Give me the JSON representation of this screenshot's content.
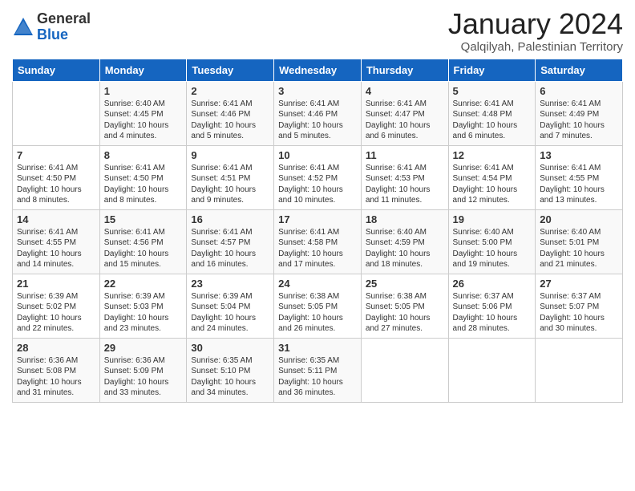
{
  "logo": {
    "general": "General",
    "blue": "Blue"
  },
  "header": {
    "month_title": "January 2024",
    "location": "Qalqilyah, Palestinian Territory"
  },
  "weekdays": [
    "Sunday",
    "Monday",
    "Tuesday",
    "Wednesday",
    "Thursday",
    "Friday",
    "Saturday"
  ],
  "weeks": [
    [
      {
        "day": "",
        "sunrise": "",
        "sunset": "",
        "daylight": ""
      },
      {
        "day": "1",
        "sunrise": "Sunrise: 6:40 AM",
        "sunset": "Sunset: 4:45 PM",
        "daylight": "Daylight: 10 hours and 4 minutes."
      },
      {
        "day": "2",
        "sunrise": "Sunrise: 6:41 AM",
        "sunset": "Sunset: 4:46 PM",
        "daylight": "Daylight: 10 hours and 5 minutes."
      },
      {
        "day": "3",
        "sunrise": "Sunrise: 6:41 AM",
        "sunset": "Sunset: 4:46 PM",
        "daylight": "Daylight: 10 hours and 5 minutes."
      },
      {
        "day": "4",
        "sunrise": "Sunrise: 6:41 AM",
        "sunset": "Sunset: 4:47 PM",
        "daylight": "Daylight: 10 hours and 6 minutes."
      },
      {
        "day": "5",
        "sunrise": "Sunrise: 6:41 AM",
        "sunset": "Sunset: 4:48 PM",
        "daylight": "Daylight: 10 hours and 6 minutes."
      },
      {
        "day": "6",
        "sunrise": "Sunrise: 6:41 AM",
        "sunset": "Sunset: 4:49 PM",
        "daylight": "Daylight: 10 hours and 7 minutes."
      }
    ],
    [
      {
        "day": "7",
        "sunrise": "Sunrise: 6:41 AM",
        "sunset": "Sunset: 4:50 PM",
        "daylight": "Daylight: 10 hours and 8 minutes."
      },
      {
        "day": "8",
        "sunrise": "Sunrise: 6:41 AM",
        "sunset": "Sunset: 4:50 PM",
        "daylight": "Daylight: 10 hours and 8 minutes."
      },
      {
        "day": "9",
        "sunrise": "Sunrise: 6:41 AM",
        "sunset": "Sunset: 4:51 PM",
        "daylight": "Daylight: 10 hours and 9 minutes."
      },
      {
        "day": "10",
        "sunrise": "Sunrise: 6:41 AM",
        "sunset": "Sunset: 4:52 PM",
        "daylight": "Daylight: 10 hours and 10 minutes."
      },
      {
        "day": "11",
        "sunrise": "Sunrise: 6:41 AM",
        "sunset": "Sunset: 4:53 PM",
        "daylight": "Daylight: 10 hours and 11 minutes."
      },
      {
        "day": "12",
        "sunrise": "Sunrise: 6:41 AM",
        "sunset": "Sunset: 4:54 PM",
        "daylight": "Daylight: 10 hours and 12 minutes."
      },
      {
        "day": "13",
        "sunrise": "Sunrise: 6:41 AM",
        "sunset": "Sunset: 4:55 PM",
        "daylight": "Daylight: 10 hours and 13 minutes."
      }
    ],
    [
      {
        "day": "14",
        "sunrise": "Sunrise: 6:41 AM",
        "sunset": "Sunset: 4:55 PM",
        "daylight": "Daylight: 10 hours and 14 minutes."
      },
      {
        "day": "15",
        "sunrise": "Sunrise: 6:41 AM",
        "sunset": "Sunset: 4:56 PM",
        "daylight": "Daylight: 10 hours and 15 minutes."
      },
      {
        "day": "16",
        "sunrise": "Sunrise: 6:41 AM",
        "sunset": "Sunset: 4:57 PM",
        "daylight": "Daylight: 10 hours and 16 minutes."
      },
      {
        "day": "17",
        "sunrise": "Sunrise: 6:41 AM",
        "sunset": "Sunset: 4:58 PM",
        "daylight": "Daylight: 10 hours and 17 minutes."
      },
      {
        "day": "18",
        "sunrise": "Sunrise: 6:40 AM",
        "sunset": "Sunset: 4:59 PM",
        "daylight": "Daylight: 10 hours and 18 minutes."
      },
      {
        "day": "19",
        "sunrise": "Sunrise: 6:40 AM",
        "sunset": "Sunset: 5:00 PM",
        "daylight": "Daylight: 10 hours and 19 minutes."
      },
      {
        "day": "20",
        "sunrise": "Sunrise: 6:40 AM",
        "sunset": "Sunset: 5:01 PM",
        "daylight": "Daylight: 10 hours and 21 minutes."
      }
    ],
    [
      {
        "day": "21",
        "sunrise": "Sunrise: 6:39 AM",
        "sunset": "Sunset: 5:02 PM",
        "daylight": "Daylight: 10 hours and 22 minutes."
      },
      {
        "day": "22",
        "sunrise": "Sunrise: 6:39 AM",
        "sunset": "Sunset: 5:03 PM",
        "daylight": "Daylight: 10 hours and 23 minutes."
      },
      {
        "day": "23",
        "sunrise": "Sunrise: 6:39 AM",
        "sunset": "Sunset: 5:04 PM",
        "daylight": "Daylight: 10 hours and 24 minutes."
      },
      {
        "day": "24",
        "sunrise": "Sunrise: 6:38 AM",
        "sunset": "Sunset: 5:05 PM",
        "daylight": "Daylight: 10 hours and 26 minutes."
      },
      {
        "day": "25",
        "sunrise": "Sunrise: 6:38 AM",
        "sunset": "Sunset: 5:05 PM",
        "daylight": "Daylight: 10 hours and 27 minutes."
      },
      {
        "day": "26",
        "sunrise": "Sunrise: 6:37 AM",
        "sunset": "Sunset: 5:06 PM",
        "daylight": "Daylight: 10 hours and 28 minutes."
      },
      {
        "day": "27",
        "sunrise": "Sunrise: 6:37 AM",
        "sunset": "Sunset: 5:07 PM",
        "daylight": "Daylight: 10 hours and 30 minutes."
      }
    ],
    [
      {
        "day": "28",
        "sunrise": "Sunrise: 6:36 AM",
        "sunset": "Sunset: 5:08 PM",
        "daylight": "Daylight: 10 hours and 31 minutes."
      },
      {
        "day": "29",
        "sunrise": "Sunrise: 6:36 AM",
        "sunset": "Sunset: 5:09 PM",
        "daylight": "Daylight: 10 hours and 33 minutes."
      },
      {
        "day": "30",
        "sunrise": "Sunrise: 6:35 AM",
        "sunset": "Sunset: 5:10 PM",
        "daylight": "Daylight: 10 hours and 34 minutes."
      },
      {
        "day": "31",
        "sunrise": "Sunrise: 6:35 AM",
        "sunset": "Sunset: 5:11 PM",
        "daylight": "Daylight: 10 hours and 36 minutes."
      },
      {
        "day": "",
        "sunrise": "",
        "sunset": "",
        "daylight": ""
      },
      {
        "day": "",
        "sunrise": "",
        "sunset": "",
        "daylight": ""
      },
      {
        "day": "",
        "sunrise": "",
        "sunset": "",
        "daylight": ""
      }
    ]
  ]
}
